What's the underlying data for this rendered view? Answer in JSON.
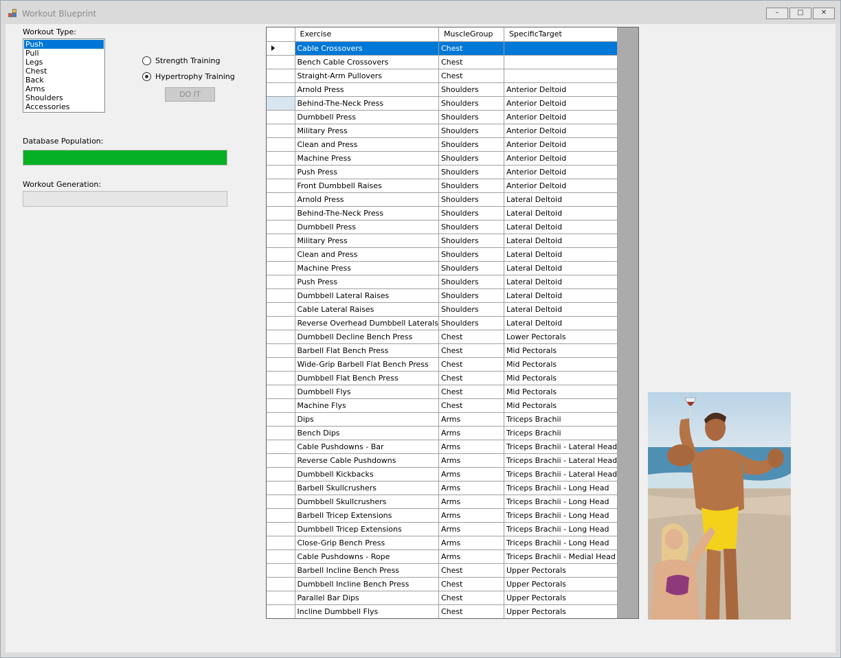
{
  "window": {
    "title": "Workout Blueprint",
    "controls": {
      "minimize": "–",
      "maximize": "□",
      "close": "✕"
    }
  },
  "left": {
    "workout_type_label": "Workout Type:",
    "workout_types": [
      "Push",
      "Pull",
      "Legs",
      "Chest",
      "Back",
      "Arms",
      "Shoulders",
      "Accessories"
    ],
    "selected_type": "Push",
    "radio_strength": "Strength Training",
    "radio_hypertrophy": "Hypertrophy Training",
    "radio_selected": "Hypertrophy Training",
    "do_it_button": "DO IT",
    "db_population_label": "Database Population:",
    "db_population_progress": 1.0,
    "workout_generation_label": "Workout Generation:",
    "workout_generation_progress": 0.0
  },
  "grid": {
    "columns": [
      "Exercise",
      "MuscleGroup",
      "SpecificTarget"
    ],
    "rows": [
      [
        "Cable Crossovers",
        "Chest",
        ""
      ],
      [
        "Bench Cable Crossovers",
        "Chest",
        ""
      ],
      [
        "Straight-Arm Pullovers",
        "Chest",
        ""
      ],
      [
        "Arnold Press",
        "Shoulders",
        "Anterior Deltoid"
      ],
      [
        "Behind-The-Neck Press",
        "Shoulders",
        "Anterior Deltoid"
      ],
      [
        "Dumbbell Press",
        "Shoulders",
        "Anterior Deltoid"
      ],
      [
        "Military Press",
        "Shoulders",
        "Anterior Deltoid"
      ],
      [
        "Clean and Press",
        "Shoulders",
        "Anterior Deltoid"
      ],
      [
        "Machine Press",
        "Shoulders",
        "Anterior Deltoid"
      ],
      [
        "Push Press",
        "Shoulders",
        "Anterior Deltoid"
      ],
      [
        "Front Dumbbell Raises",
        "Shoulders",
        "Anterior Deltoid"
      ],
      [
        "Arnold Press",
        "Shoulders",
        "Lateral Deltoid"
      ],
      [
        "Behind-The-Neck Press",
        "Shoulders",
        "Lateral Deltoid"
      ],
      [
        "Dumbbell Press",
        "Shoulders",
        "Lateral Deltoid"
      ],
      [
        "Military Press",
        "Shoulders",
        "Lateral Deltoid"
      ],
      [
        "Clean and Press",
        "Shoulders",
        "Lateral Deltoid"
      ],
      [
        "Machine Press",
        "Shoulders",
        "Lateral Deltoid"
      ],
      [
        "Push Press",
        "Shoulders",
        "Lateral Deltoid"
      ],
      [
        "Dumbbell Lateral Raises",
        "Shoulders",
        "Lateral Deltoid"
      ],
      [
        "Cable Lateral Raises",
        "Shoulders",
        "Lateral Deltoid"
      ],
      [
        "Reverse Overhead Dumbbell Laterals",
        "Shoulders",
        "Lateral Deltoid"
      ],
      [
        "Dumbbell Decline Bench Press",
        "Chest",
        "Lower Pectorals"
      ],
      [
        "Barbell Flat Bench Press",
        "Chest",
        "Mid Pectorals"
      ],
      [
        "Wide-Grip Barbell Flat Bench Press",
        "Chest",
        "Mid Pectorals"
      ],
      [
        "Dumbbell Flat Bench Press",
        "Chest",
        "Mid Pectorals"
      ],
      [
        "Dumbbell Flys",
        "Chest",
        "Mid Pectorals"
      ],
      [
        "Machine Flys",
        "Chest",
        "Mid Pectorals"
      ],
      [
        "Dips",
        "Arms",
        "Triceps Brachii"
      ],
      [
        "Bench Dips",
        "Arms",
        "Triceps Brachii"
      ],
      [
        "Cable Pushdowns - Bar",
        "Arms",
        "Triceps Brachii - Lateral Head"
      ],
      [
        "Reverse Cable Pushdowns",
        "Arms",
        "Triceps Brachii - Lateral Head"
      ],
      [
        "Dumbbell Kickbacks",
        "Arms",
        "Triceps Brachii - Lateral Head"
      ],
      [
        "Barbell Skullcrushers",
        "Arms",
        "Triceps Brachii - Long Head"
      ],
      [
        "Dumbbell Skullcrushers",
        "Arms",
        "Triceps Brachii - Long Head"
      ],
      [
        "Barbell Tricep Extensions",
        "Arms",
        "Triceps Brachii - Long Head"
      ],
      [
        "Dumbbell Tricep Extensions",
        "Arms",
        "Triceps Brachii - Long Head"
      ],
      [
        "Close-Grip Bench Press",
        "Arms",
        "Triceps Brachii - Long Head"
      ],
      [
        "Cable Pushdowns - Rope",
        "Arms",
        "Triceps Brachii - Medial Head"
      ],
      [
        "Barbell Incline Bench Press",
        "Chest",
        "Upper Pectorals"
      ],
      [
        "Dumbbell Incline Bench Press",
        "Chest",
        "Upper Pectorals"
      ],
      [
        "Parallel Bar Dips",
        "Chest",
        "Upper Pectorals"
      ],
      [
        "Incline Dumbbell Flys",
        "Chest",
        "Upper Pectorals"
      ]
    ],
    "selected_row": 0,
    "hover_row": 4
  },
  "colors": {
    "accent": "#0078d7",
    "progress_green": "#06b025",
    "grid_background": "#ababab"
  }
}
